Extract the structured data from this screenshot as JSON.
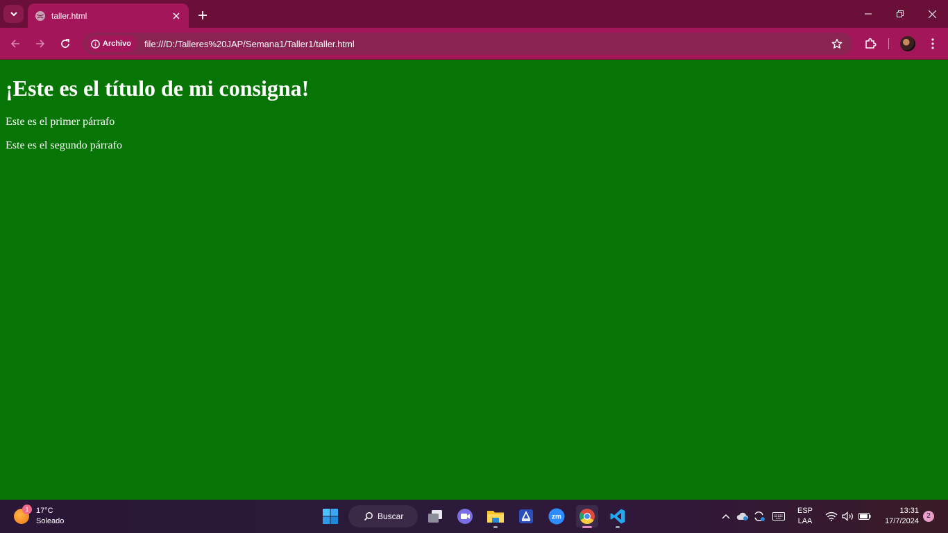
{
  "browser": {
    "tab": {
      "title": "taller.html"
    },
    "address": {
      "security_chip": "Archivo",
      "url": "file:///D:/Talleres%20JAP/Semana1/Taller1/taller.html"
    },
    "colors": {
      "frame": "#6a0f38",
      "tab_active": "#a3175a"
    }
  },
  "page": {
    "background": "#067506",
    "heading": "¡Este es el título de mi consigna!",
    "paragraphs": [
      "Este es el primer párrafo",
      "Este es el segundo párrafo"
    ]
  },
  "taskbar": {
    "weather": {
      "temp": "17°C",
      "condition": "Soleado",
      "badge": "1"
    },
    "search_label": "Buscar",
    "pinned": [
      "windows-start-icon",
      "task-view-icon",
      "teams-icon",
      "file-explorer-icon",
      "store-icon",
      "zoom-icon",
      "chrome-icon",
      "vscode-icon"
    ],
    "language": {
      "line1": "ESP",
      "line2": "LAA"
    },
    "clock": {
      "time": "13:31",
      "date": "17/7/2024"
    },
    "notifications": "2"
  }
}
